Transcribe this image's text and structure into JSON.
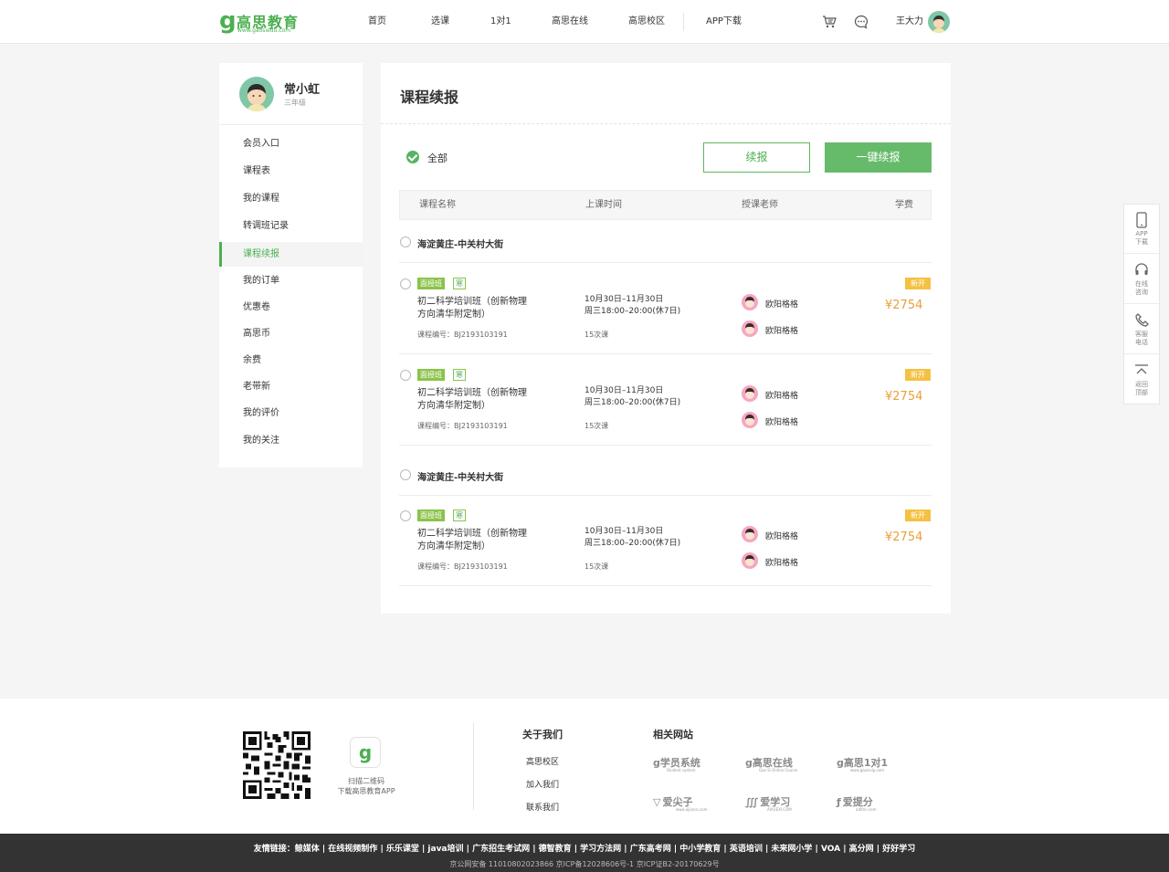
{
  "header": {
    "logo_text": "高思教育",
    "logo_url": "www.gaosiedu.com",
    "nav": [
      "首页",
      "选课",
      "1对1",
      "高思在线",
      "高思校区",
      "APP下载"
    ],
    "username": "王大力",
    "icons": [
      "cart-icon",
      "message-icon"
    ]
  },
  "sidebar": {
    "name": "常小虹",
    "grade": "三年级",
    "items": [
      "会员入口",
      "课程表",
      "我的课程",
      "转调班记录",
      "课程续报",
      "我的订单",
      "优惠卷",
      "高思币",
      "余费",
      "老带新",
      "我的评价",
      "我的关注"
    ],
    "active_index": 4
  },
  "main": {
    "title": "课程续报",
    "all_label": "全部",
    "btn_renew": "续报",
    "btn_onekey": "一键续报",
    "columns": [
      "课程名称",
      "上课时间",
      "授课老师",
      "学费"
    ],
    "groups": [
      {
        "campus": "海淀黄庄-中关村大街",
        "courses": [
          {
            "tag": "面授班",
            "season": "寒",
            "name_line1": "初二科学培训班（创新物理",
            "name_line2": "方向清华附定制）",
            "course_no": "课程编号：BJ2193103191",
            "date": "10月30日–11月30日",
            "weekly": "周三18:00–20:00(休7日)",
            "lessons": "15次课",
            "teachers": [
              "欧阳格格",
              "欧阳格格"
            ],
            "badge": "新开",
            "price": "¥2754"
          },
          {
            "tag": "面授班",
            "season": "寒",
            "name_line1": "初二科学培训班（创新物理",
            "name_line2": "方向清华附定制）",
            "course_no": "课程编号：BJ2193103191",
            "date": "10月30日–11月30日",
            "weekly": "周三18:00–20:00(休7日)",
            "lessons": "15次课",
            "teachers": [
              "欧阳格格",
              "欧阳格格"
            ],
            "badge": "新开",
            "price": "¥2754"
          }
        ]
      },
      {
        "campus": "海淀黄庄-中关村大街",
        "courses": [
          {
            "tag": "面授班",
            "season": "寒",
            "name_line1": "初二科学培训班（创新物理",
            "name_line2": "方向清华附定制）",
            "course_no": "课程编号：BJ2193103191",
            "date": "10月30日–11月30日",
            "weekly": "周三18:00–20:00(休7日)",
            "lessons": "15次课",
            "teachers": [
              "欧阳格格",
              "欧阳格格"
            ],
            "badge": "新开",
            "price": "¥2754"
          }
        ]
      }
    ]
  },
  "float_bar": [
    {
      "icon": "phone-icon",
      "line1": "APP",
      "line2": "下载"
    },
    {
      "icon": "headset-icon",
      "line1": "在线",
      "line2": "咨询"
    },
    {
      "icon": "telephone-icon",
      "line1": "客服",
      "line2": "电话"
    },
    {
      "icon": "back-to-top-icon",
      "line1": "返回",
      "line2": "顶部"
    }
  ],
  "footer": {
    "qr_caption_1": "扫描二维码",
    "qr_caption_2": "下载高思教育APP",
    "about_title": "关于我们",
    "about_links": [
      "高思校区",
      "加入我们",
      "联系我们"
    ],
    "related_title": "相关网站",
    "sites": [
      {
        "name": "学员系统",
        "sub": "Student system"
      },
      {
        "name": "高思在线",
        "sub": "Gao Si Online Course"
      },
      {
        "name": "高思1对1",
        "sub": "www.gaosivip.com"
      },
      {
        "name": "爱尖子",
        "sub": "www.aijianzi.com"
      },
      {
        "name": "爱学习",
        "sub": "AIXUEXI.COM"
      },
      {
        "name": "爱提分",
        "sub": "aitifen.com"
      }
    ],
    "friend_links": "友情链接：鲸媒体 | 在线视频制作 | 乐乐课堂 | java培训 | 广东招生考试网 | 德智教育 | 学习方法网 | 广东高考网 | 中小学教育 | 英语培训 | 未来网小学 | VOA | 高分网 | 好好学习",
    "icp": "京公网安备 11010802023866   京ICP备12028606号-1   京ICP证B2-20170629号"
  }
}
